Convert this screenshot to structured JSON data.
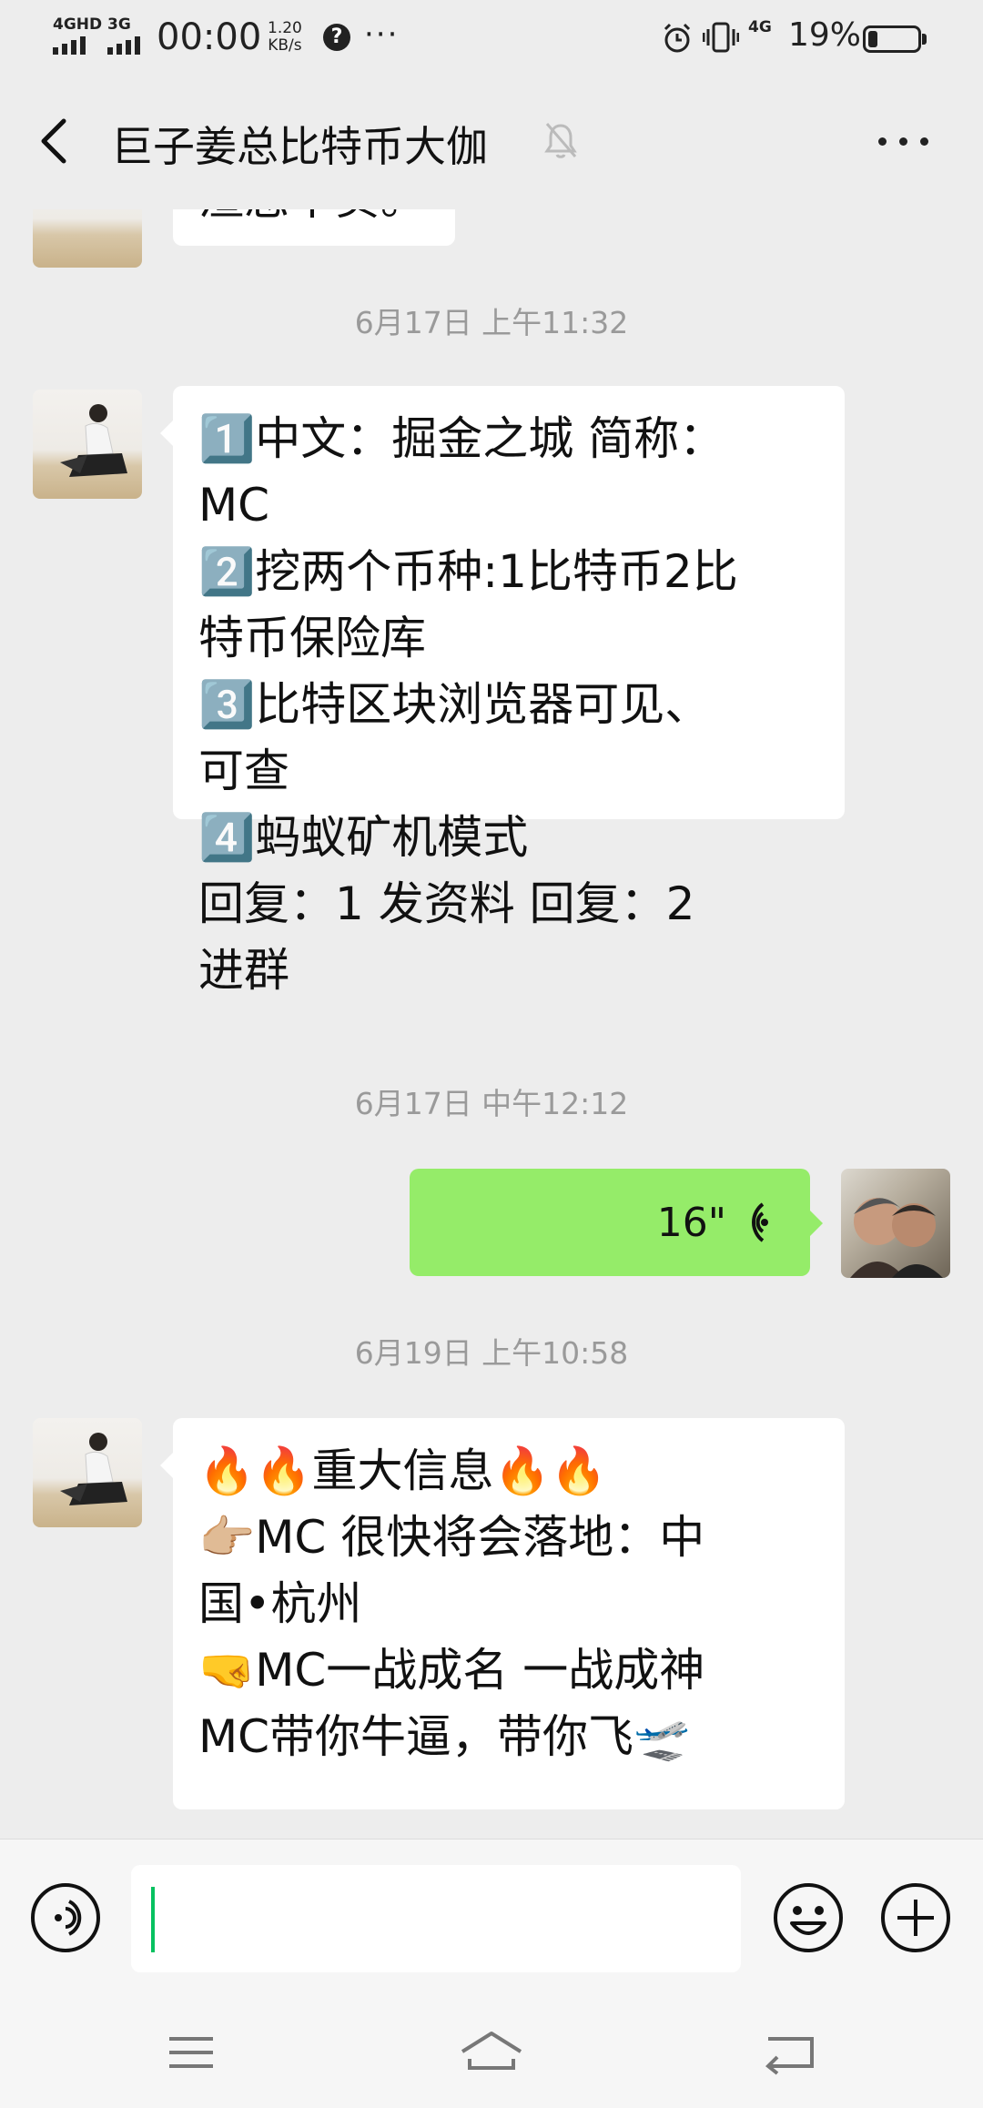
{
  "status_bar": {
    "net_1": "4GHD",
    "net_2": "3G",
    "time": "00:00",
    "speed_value": "1.20",
    "speed_unit": "KB/s",
    "net_3": "4G",
    "battery_pct": "19%",
    "battery_level": 0.19
  },
  "header": {
    "title": "巨子姜总比特币大伽"
  },
  "messages": {
    "top_fragment": "渣您不负。",
    "timestamp_1": "6月17日 上午11:32",
    "msg_1": {
      "line_1": "1️⃣中文：掘金之城  简称：",
      "line_2": "MC",
      "line_3": "2️⃣挖两个币种:1比特币2比",
      "line_4": "特币保险库",
      "line_5": "3️⃣比特区块浏览器可见、",
      "line_6": "可查",
      "line_7": "4️⃣蚂蚁矿机模式",
      "line_8": "回复：1 发资料    回复：2",
      "line_9": "进群"
    },
    "timestamp_2": "6月17日 中午12:12",
    "voice_duration": "16\"",
    "timestamp_3": "6月19日 上午10:58",
    "msg_2": {
      "line_1": "🔥🔥重大信息🔥🔥",
      "line_2": "👉🏼MC 很快将会落地：中",
      "line_3": "国•杭州",
      "line_4": "🤜MC一战成名 一战成神",
      "line_5": "  MC带你牛逼，带你飞🛫"
    }
  },
  "input": {
    "value": ""
  },
  "colors": {
    "background": "#ededed",
    "sent_bubble": "#95ec69",
    "received_bubble": "#ffffff",
    "caret": "#07c160"
  }
}
